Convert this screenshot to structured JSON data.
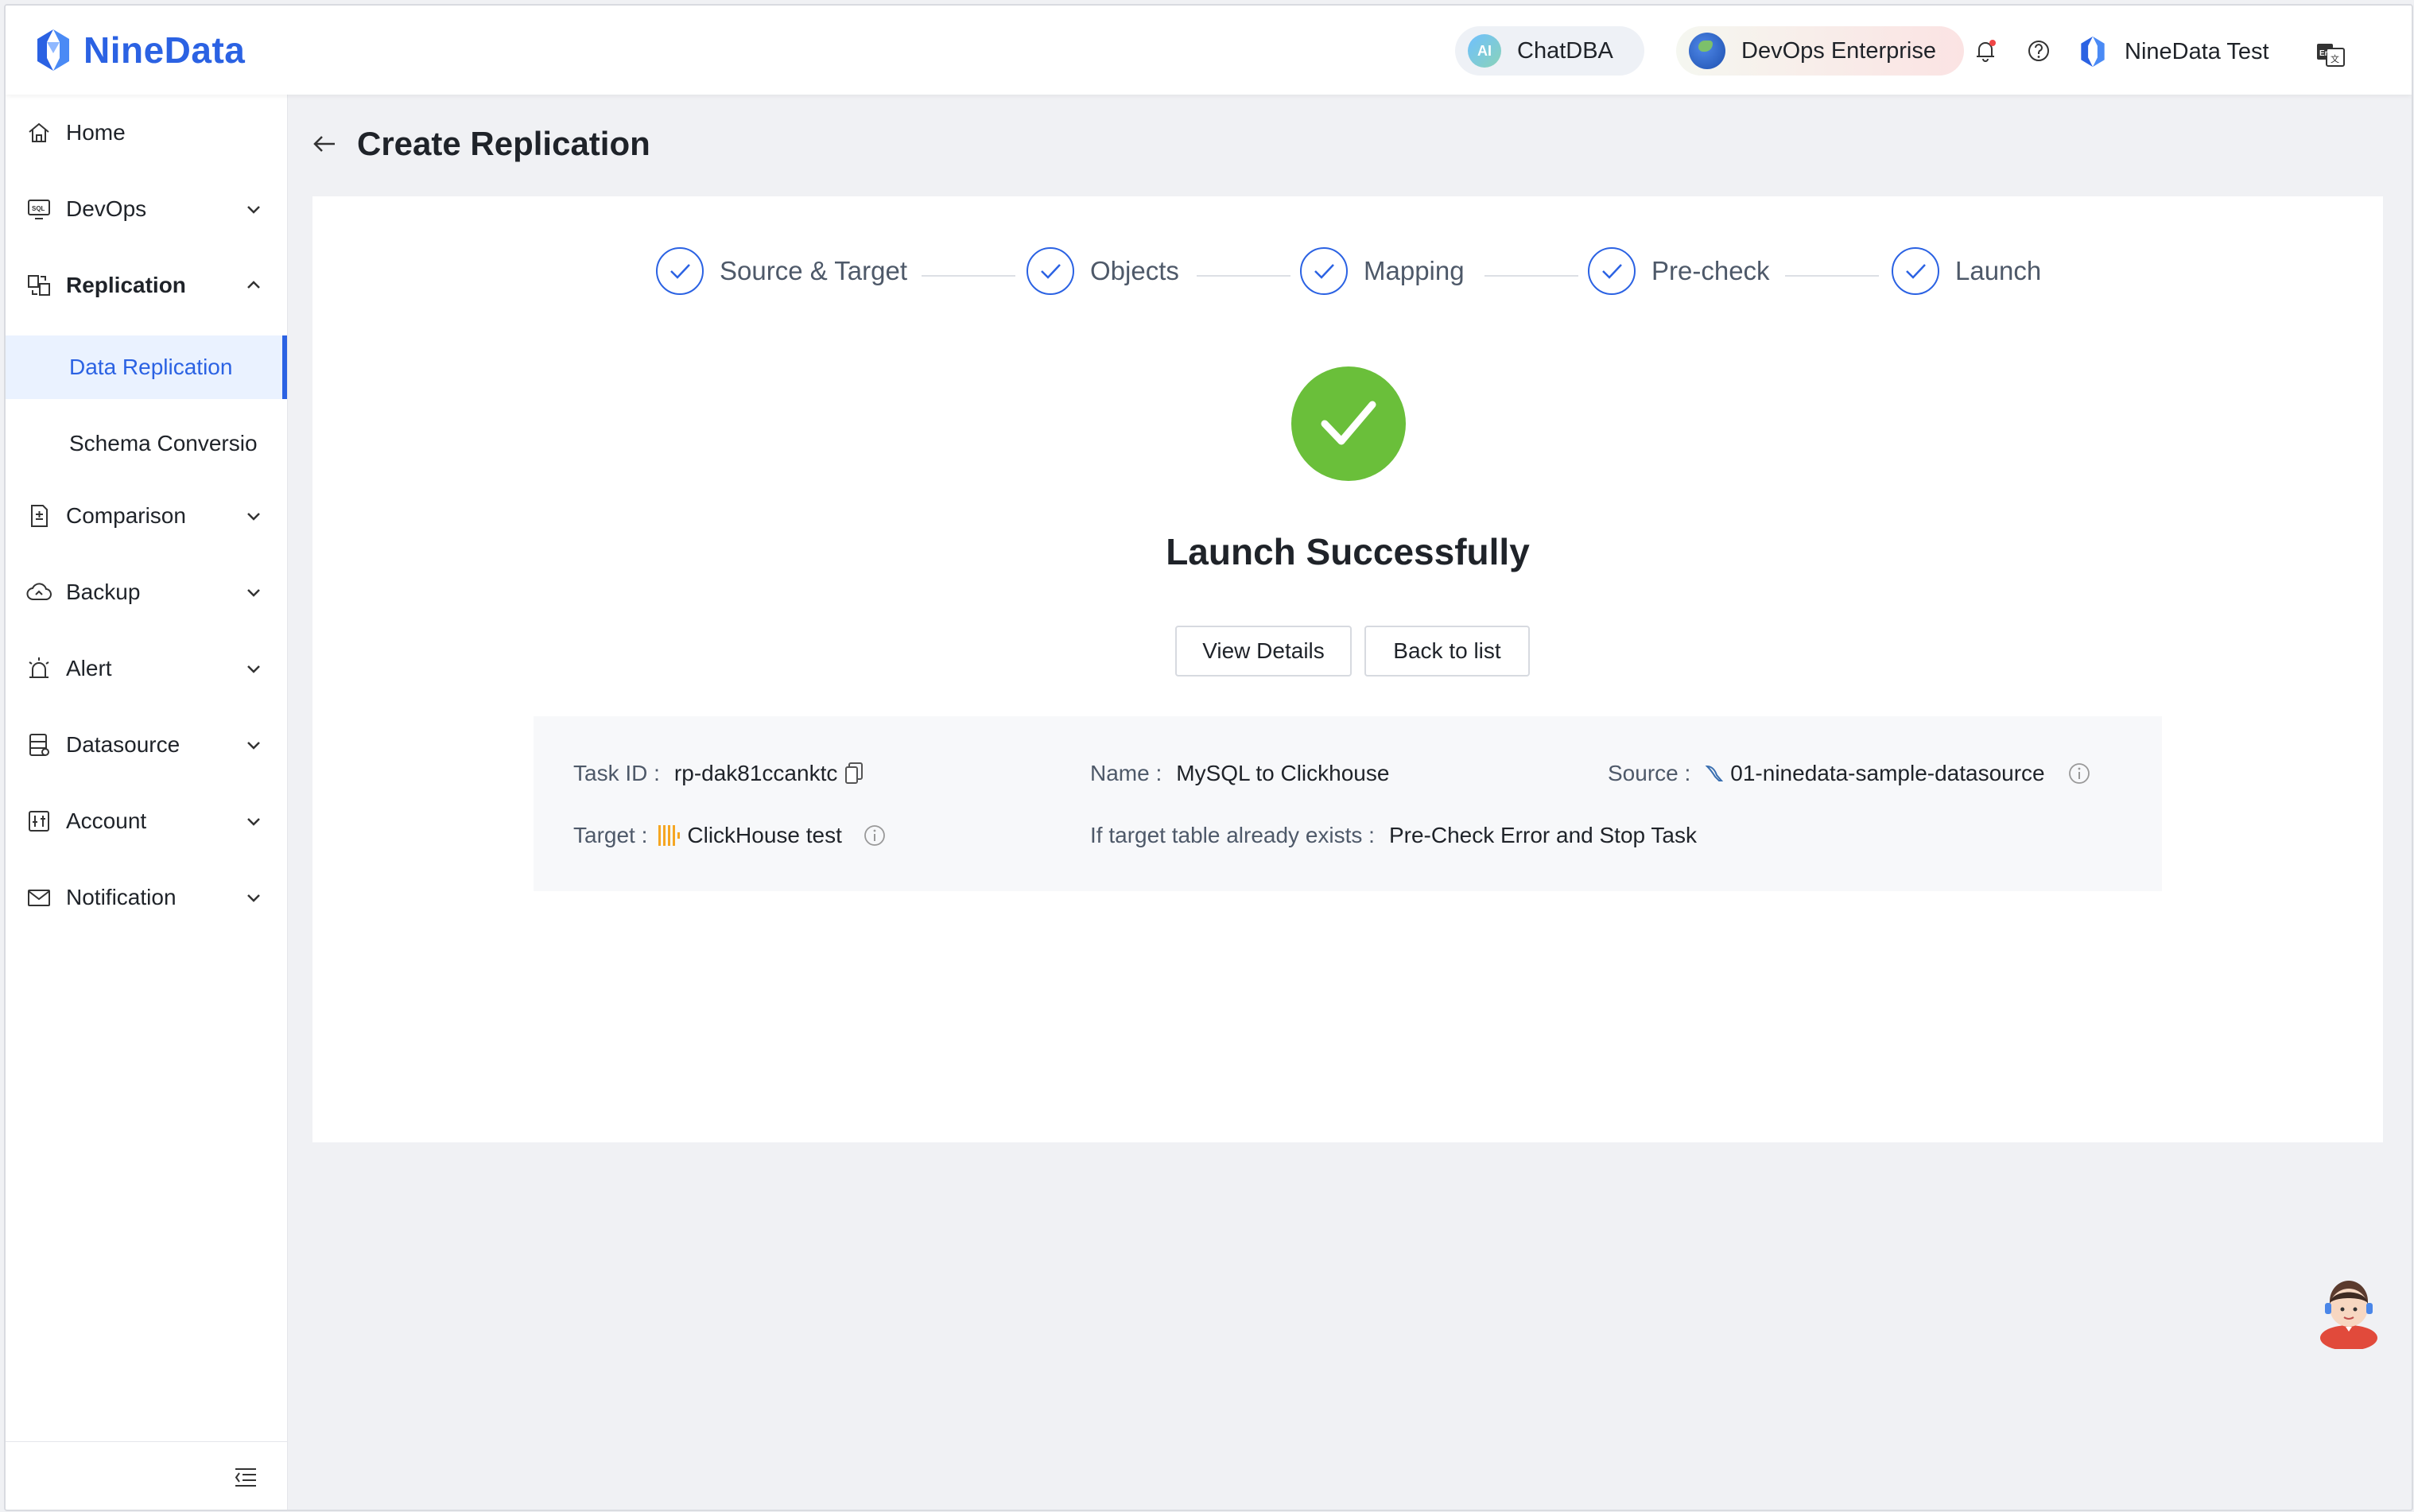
{
  "header": {
    "brand": "NineData",
    "chatdba": "ChatDBA",
    "ai_badge": "AI",
    "edition": "DevOps Enterprise",
    "user": "NineData Test"
  },
  "sidebar": {
    "items": [
      {
        "label": "Home"
      },
      {
        "label": "DevOps"
      },
      {
        "label": "Replication"
      },
      {
        "label": "Comparison"
      },
      {
        "label": "Backup"
      },
      {
        "label": "Alert"
      },
      {
        "label": "Datasource"
      },
      {
        "label": "Account"
      },
      {
        "label": "Notification"
      }
    ],
    "sub_items": [
      {
        "label": "Data Replication"
      },
      {
        "label": "Schema Conversio"
      }
    ]
  },
  "page": {
    "title": "Create Replication",
    "steps": [
      "Source & Target",
      "Objects",
      "Mapping",
      "Pre-check",
      "Launch"
    ],
    "status": "Launch Successfully",
    "view_details": "View Details",
    "back_to_list": "Back to list"
  },
  "info": {
    "task_id_label": "Task ID :",
    "task_id": "rp-dak81ccanktc",
    "name_label": "Name :",
    "name": "MySQL to Clickhouse",
    "source_label": "Source :",
    "source": "01-ninedata-sample-datasource",
    "target_label": "Target :",
    "target": "ClickHouse test",
    "exists_label": "If target table already exists :",
    "exists_value": "Pre-Check Error and Stop Task"
  },
  "colors": {
    "accent": "#2b62e3",
    "success": "#6abf3a"
  }
}
